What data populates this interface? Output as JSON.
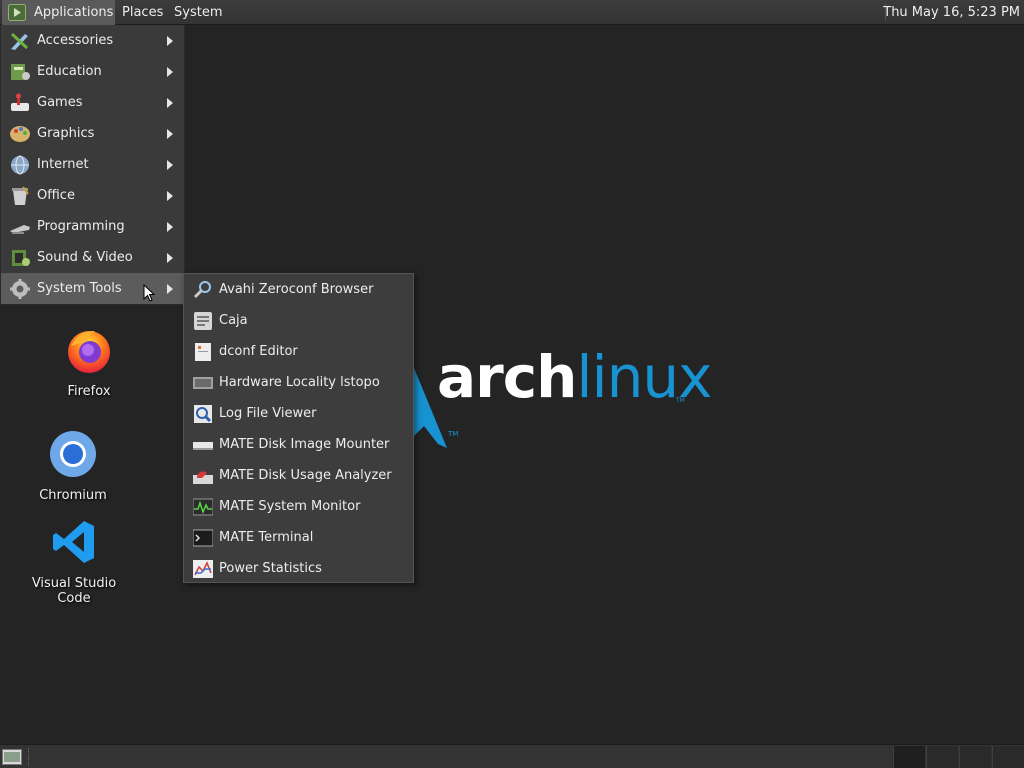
{
  "top_panel": {
    "applications": "Applications",
    "places": "Places",
    "system": "System",
    "clock": "Thu May 16,  5:23 PM"
  },
  "desktop": {
    "background_logo": {
      "arch": "arch",
      "linux": "linux"
    },
    "icons": [
      {
        "label": "Firefox",
        "icon": "firefox-icon"
      },
      {
        "label": "Chromium",
        "icon": "chromium-icon"
      },
      {
        "label": "Visual Studio Code",
        "icon": "vscode-icon"
      }
    ]
  },
  "applications_menu": {
    "items": [
      {
        "label": "Accessories",
        "icon": "accessories-icon",
        "has_submenu": true
      },
      {
        "label": "Education",
        "icon": "education-icon",
        "has_submenu": true
      },
      {
        "label": "Games",
        "icon": "games-icon",
        "has_submenu": true
      },
      {
        "label": "Graphics",
        "icon": "graphics-icon",
        "has_submenu": true
      },
      {
        "label": "Internet",
        "icon": "internet-icon",
        "has_submenu": true
      },
      {
        "label": "Office",
        "icon": "office-icon",
        "has_submenu": true
      },
      {
        "label": "Programming",
        "icon": "programming-icon",
        "has_submenu": true
      },
      {
        "label": "Sound & Video",
        "icon": "sound-video-icon",
        "has_submenu": true
      },
      {
        "label": "System Tools",
        "icon": "system-tools-icon",
        "has_submenu": true,
        "selected": true
      }
    ]
  },
  "system_tools_submenu": {
    "items": [
      {
        "label": "Avahi Zeroconf Browser",
        "icon": "network-search-icon"
      },
      {
        "label": "Caja",
        "icon": "file-manager-icon"
      },
      {
        "label": "dconf Editor",
        "icon": "dconf-editor-icon"
      },
      {
        "label": "Hardware Locality lstopo",
        "icon": "hardware-icon"
      },
      {
        "label": "Log File Viewer",
        "icon": "log-viewer-icon"
      },
      {
        "label": "MATE Disk Image Mounter",
        "icon": "disk-image-icon"
      },
      {
        "label": "MATE Disk Usage Analyzer",
        "icon": "disk-usage-icon"
      },
      {
        "label": "MATE System Monitor",
        "icon": "system-monitor-icon"
      },
      {
        "label": "MATE Terminal",
        "icon": "terminal-icon"
      },
      {
        "label": "Power Statistics",
        "icon": "power-statistics-icon"
      }
    ]
  },
  "colors": {
    "desktop_bg": "#242424",
    "panel_bg": "#333333",
    "menu_bg": "#3a3a3a",
    "menu_selected": "#5c5c5c",
    "arch_blue": "#1793d1"
  }
}
